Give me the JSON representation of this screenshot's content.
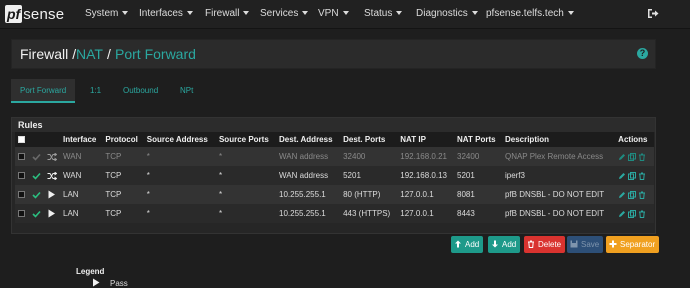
{
  "nav": {
    "logo_pf": "pf",
    "logo_sense": "sense",
    "items": [
      "System",
      "Interfaces",
      "Firewall",
      "Services",
      "VPN",
      "Status",
      "Diagnostics",
      "pfsense.telfs.tech"
    ]
  },
  "breadcrumb": {
    "level1": "Firewall",
    "level2": "NAT",
    "level3": "Port Forward",
    "separator": "/"
  },
  "help_icon": "?",
  "tabs": [
    "Port Forward",
    "1:1",
    "Outbound",
    "NPt"
  ],
  "panel": {
    "title": "Rules"
  },
  "table": {
    "headers": [
      "Interface",
      "Protocol",
      "Source Address",
      "Source Ports",
      "Dest. Address",
      "Dest. Ports",
      "NAT IP",
      "NAT Ports",
      "Description",
      "Actions"
    ],
    "rows": [
      {
        "status": "disabled",
        "icon": "shuffle-icon",
        "cells": [
          "WAN",
          "TCP",
          "*",
          "*",
          "WAN address",
          "32400",
          "192.168.0.21",
          "32400",
          "QNAP Plex Remote Access"
        ]
      },
      {
        "status": "enabled",
        "icon": "shuffle-icon",
        "cells": [
          "WAN",
          "TCP",
          "*",
          "*",
          "WAN address",
          "5201",
          "192.168.0.13",
          "5201",
          "iperf3"
        ]
      },
      {
        "status": "enabled",
        "icon": "play-icon",
        "cells": [
          "LAN",
          "TCP",
          "*",
          "*",
          "10.255.255.1",
          "80 (HTTP)",
          "127.0.0.1",
          "8081",
          "pfB DNSBL - DO NOT EDIT"
        ]
      },
      {
        "status": "enabled",
        "icon": "play-icon",
        "cells": [
          "LAN",
          "TCP",
          "*",
          "*",
          "10.255.255.1",
          "443 (HTTPS)",
          "127.0.0.1",
          "8443",
          "pfB DNSBL - DO NOT EDIT"
        ]
      }
    ]
  },
  "buttons": {
    "add_top": "Add",
    "add_bottom": "Add",
    "delete": "Delete",
    "save": "Save",
    "separator": "Separator"
  },
  "colors": {
    "accent": "#2ba8a0",
    "add": "#1e9a8a",
    "delete": "#d9332f",
    "save": "#2d4f77",
    "separator": "#f0a020"
  },
  "legend": {
    "title": "Legend",
    "pass": "Pass"
  }
}
